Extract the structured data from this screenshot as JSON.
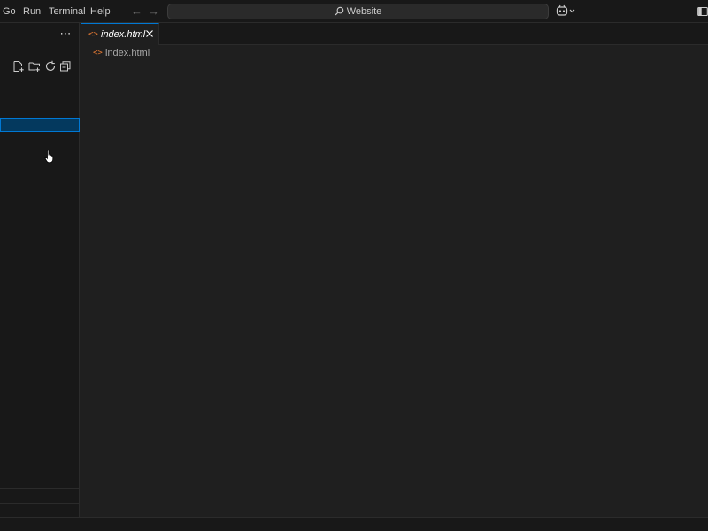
{
  "menu": {
    "items": [
      {
        "label": "Go"
      },
      {
        "label": "Run"
      },
      {
        "label": "Terminal"
      },
      {
        "label": "Help"
      }
    ]
  },
  "nav": {
    "back_icon": "arrow-left-icon",
    "forward_icon": "arrow-right-icon"
  },
  "command_center": {
    "text": "Website",
    "icon": "search-icon"
  },
  "copilot": {
    "icon": "copilot-icon"
  },
  "sidebar": {
    "more_icon": "ellipsis-icon",
    "actions": [
      "new-file-icon",
      "new-folder-icon",
      "refresh-icon",
      "collapse-all-icon"
    ]
  },
  "tab": {
    "label": "index.html",
    "icon": "html-file-icon"
  },
  "breadcrumb": {
    "label": "index.html",
    "icon": "html-file-icon"
  },
  "colors": {
    "accent": "#0078d4",
    "selection": "#04395e",
    "html_icon": "#e37933",
    "editor_bg": "#1f1f1f",
    "chrome_bg": "#181818"
  }
}
